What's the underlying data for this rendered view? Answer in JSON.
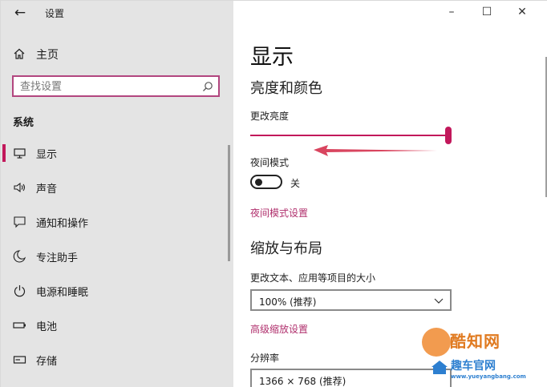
{
  "window": {
    "title": "设置",
    "controls": {
      "minimize": "–",
      "maximize": "☐",
      "close": "✕"
    }
  },
  "sidebar": {
    "home_label": "主页",
    "search_placeholder": "查找设置",
    "section_label": "系统",
    "items": [
      {
        "label": "显示",
        "icon": "monitor-icon",
        "active": true
      },
      {
        "label": "声音",
        "icon": "speaker-icon",
        "active": false
      },
      {
        "label": "通知和操作",
        "icon": "notification-icon",
        "active": false
      },
      {
        "label": "专注助手",
        "icon": "moon-icon",
        "active": false
      },
      {
        "label": "电源和睡眠",
        "icon": "power-icon",
        "active": false
      },
      {
        "label": "电池",
        "icon": "battery-icon",
        "active": false
      },
      {
        "label": "存储",
        "icon": "storage-icon",
        "active": false
      }
    ]
  },
  "main": {
    "page_title": "显示",
    "brightness_section": "亮度和颜色",
    "brightness_label": "更改亮度",
    "brightness_level": 1.0,
    "night_light_label": "夜间模式",
    "night_light_state": "关",
    "night_light_settings_link": "夜间模式设置",
    "scale_section": "缩放与布局",
    "scale_label": "更改文本、应用等项目的大小",
    "scale_value": "100% (推荐)",
    "advanced_scaling_link": "高级缩放设置",
    "resolution_label": "分辨率",
    "resolution_value": "1366 × 768 (推荐)"
  },
  "watermark": {
    "brand": "酷知网",
    "sub": "趣车官网",
    "url": "www.yueyangbang.com"
  },
  "colors": {
    "accent": "#c2185b",
    "link": "#b0306d",
    "sidebar_bg": "#e4e4e4",
    "annotation_arrow": "#d9455f"
  }
}
